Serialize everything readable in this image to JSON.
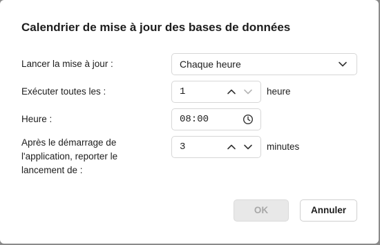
{
  "dialog": {
    "title": "Calendrier de mise à jour des bases de données"
  },
  "rows": {
    "launch": {
      "label": "Lancer la mise à jour :",
      "value": "Chaque heure"
    },
    "every": {
      "label": "Exécuter toutes les :",
      "value": "1",
      "unit": "heure"
    },
    "time": {
      "label": "Heure :",
      "value": "08:00"
    },
    "delay": {
      "label_line1": "Après le démarrage de",
      "label_line2": "l'application, reporter le",
      "label_line3": "lancement de :",
      "value": "3",
      "unit": "minutes"
    }
  },
  "buttons": {
    "ok": "OK",
    "cancel": "Annuler"
  },
  "icons": {
    "dropdown": "chevron-down-icon",
    "up": "chevron-up-icon",
    "down": "chevron-down-icon",
    "clock": "clock-icon"
  }
}
